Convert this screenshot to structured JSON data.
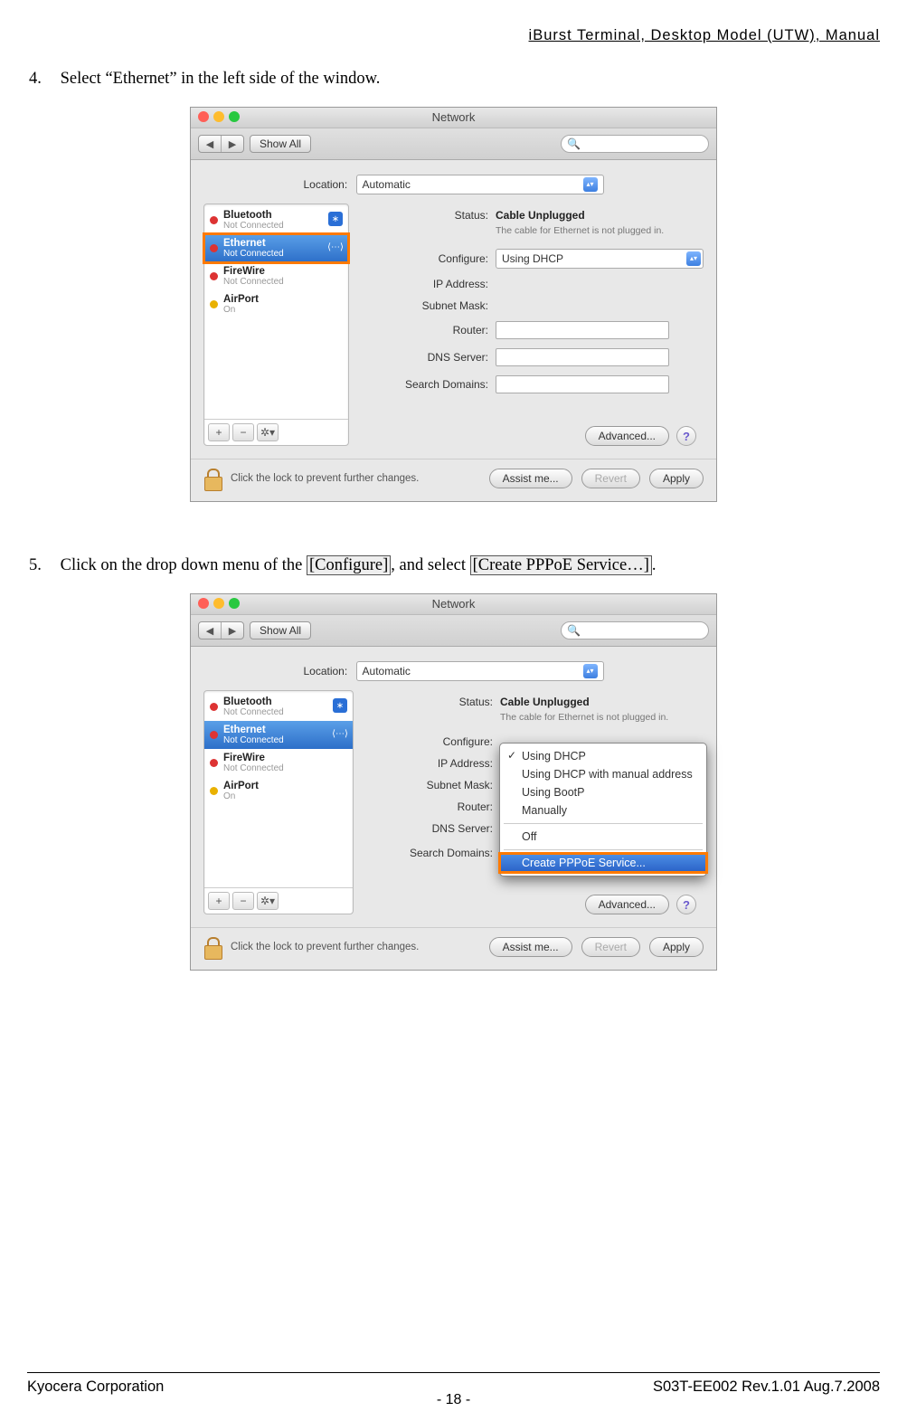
{
  "header": "iBurst Terminal, Desktop Model (UTW), Manual",
  "step4": {
    "num": "4.",
    "text": "Select “Ethernet” in the left side of the window."
  },
  "step5": {
    "num": "5.",
    "prefix": "Click on the drop down menu of the ",
    "ref1": "[Configure]",
    "middle": ", and select ",
    "ref2": "[Create PPPoE Service…]",
    "suffix": "."
  },
  "win": {
    "title": "Network",
    "showAll": "Show All",
    "locationLabel": "Location:",
    "locationValue": "Automatic",
    "sidebar": [
      {
        "name": "Bluetooth",
        "sub": "Not Connected",
        "dot": "red",
        "ic": "bt"
      },
      {
        "name": "Ethernet",
        "sub": "Not Connected",
        "dot": "red",
        "ic": "eth",
        "selected": true
      },
      {
        "name": "FireWire",
        "sub": "Not Connected",
        "dot": "red",
        "ic": "fw"
      },
      {
        "name": "AirPort",
        "sub": "On",
        "dot": "yel",
        "ic": "wifi"
      }
    ],
    "statusLabel": "Status:",
    "statusValue": "Cable Unplugged",
    "statusHint": "The cable for Ethernet is not plugged in.",
    "configureLabel": "Configure:",
    "configureValue": "Using DHCP",
    "ipLabel": "IP Address:",
    "subnetLabel": "Subnet Mask:",
    "routerLabel": "Router:",
    "dnsLabel": "DNS Server:",
    "searchLabel": "Search Domains:",
    "advanced": "Advanced...",
    "lockText": "Click the lock to prevent further changes.",
    "assist": "Assist me...",
    "revert": "Revert",
    "apply": "Apply",
    "menu": {
      "i1": "Using DHCP",
      "i2": "Using DHCP with manual address",
      "i3": "Using BootP",
      "i4": "Manually",
      "i5": "Off",
      "i6": "Create PPPoE Service..."
    }
  },
  "footer": {
    "left": "Kyocera Corporation",
    "right": "S03T-EE002 Rev.1.01 Aug.7.2008",
    "page": "- 18 -"
  }
}
